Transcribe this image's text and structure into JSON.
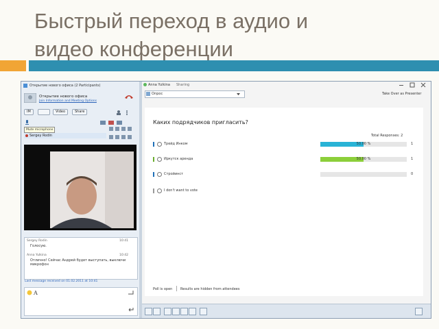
{
  "slide": {
    "title": "Быстрый переход в аудио и\nвидео конференции"
  },
  "colors": {
    "accent_orange": "#f1a535",
    "accent_blue": "#2e8fb0",
    "poll_bar_blue": "#29b3d6",
    "poll_bar_green": "#8ccf3a"
  },
  "left_panel": {
    "window_title": "Открытие нового офиса (2 Participants)",
    "meeting_name": "Открытие нового офиса",
    "meeting_link": "Join Information and Meeting Options",
    "buttons": {
      "im": "IM",
      "video": "Video",
      "share": "Share"
    },
    "tooltip": "Mute microphone",
    "participant": "Sergey Rodin",
    "chat": [
      {
        "author": "Sergey Rodin",
        "time": "10:41",
        "text": "Голосую."
      },
      {
        "author": "Anna Yulkina",
        "time": "10:42",
        "text": "Отлично! Сейчас Андрей будет выступать, выключи микрофон"
      }
    ],
    "last_message": "Last message received on 01.02.2011 at 10:41"
  },
  "right_panel": {
    "presenter": "Anna Yulkina",
    "status": "Sharing",
    "content_label": "Опрос",
    "take_over": "Take Over as Presenter",
    "question": "Каких подрядчиков пригласить?",
    "total_label": "Total Responses: 2",
    "options": [
      {
        "label": "Трейд Инком",
        "percent_text": "50.00 %",
        "percent": 50,
        "count": "1",
        "color": "#29b3d6",
        "bar": "#1f6fb8"
      },
      {
        "label": "Иркутск аренда",
        "percent_text": "50.00 %",
        "percent": 50,
        "count": "1",
        "color": "#8ccf3a",
        "bar": "#6aad2e"
      },
      {
        "label": "Стройинст",
        "percent_text": "",
        "percent": 0,
        "count": "0",
        "color": "#29b3d6",
        "bar": "#1f6fb8"
      },
      {
        "label": "I don't want to vote",
        "percent_text": "",
        "percent": 0,
        "count": "",
        "color": "#999999",
        "bar": "#999999"
      }
    ],
    "poll_status": "Poll is open",
    "results_status": "Results are hidden from attendees"
  }
}
